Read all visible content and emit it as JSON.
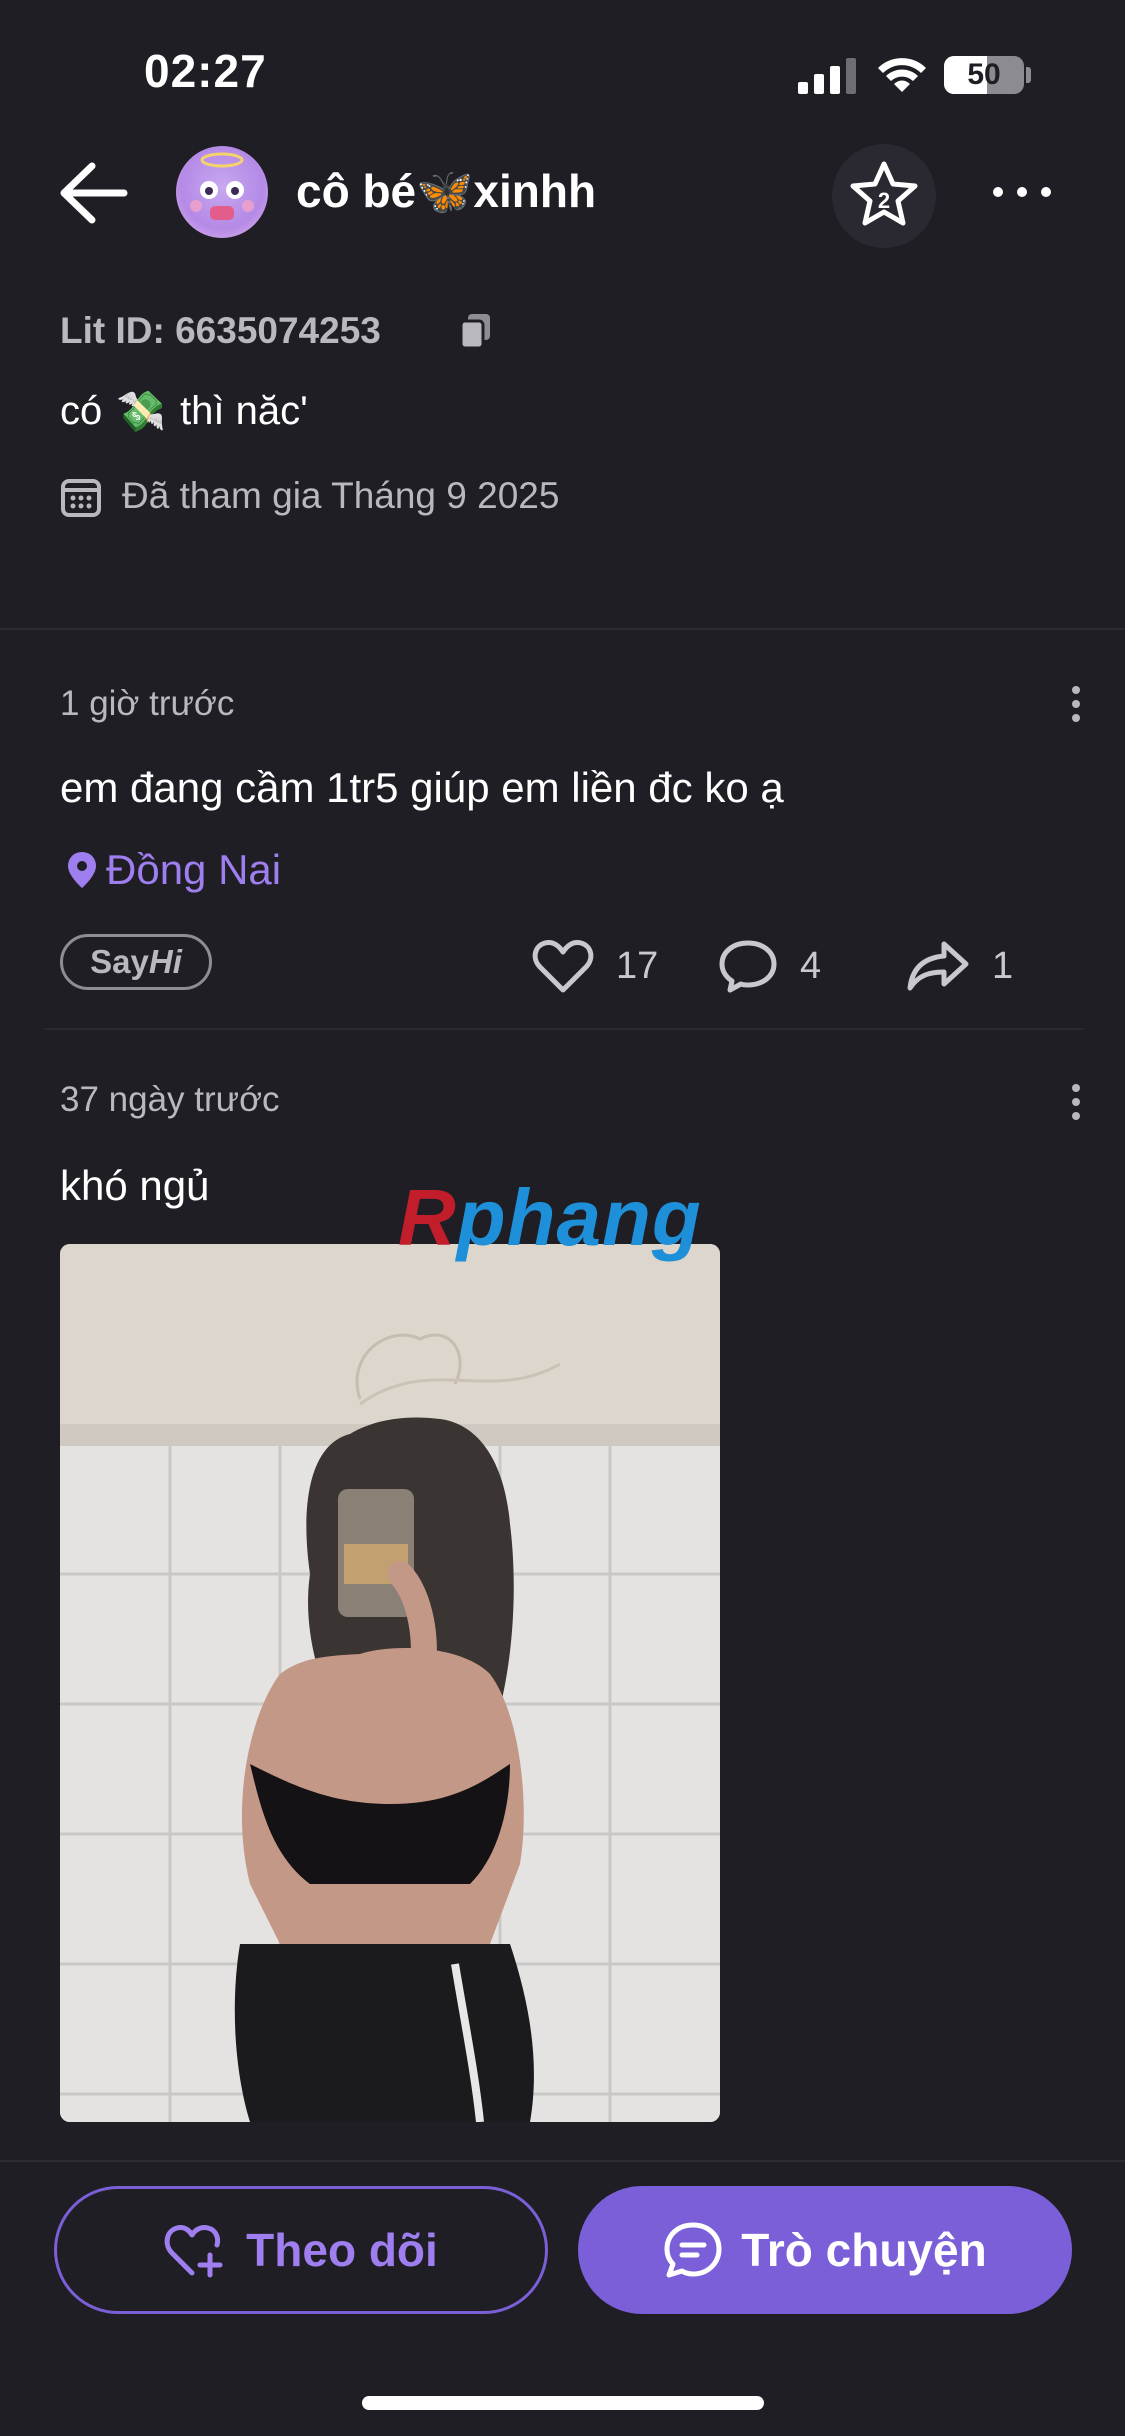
{
  "status_bar": {
    "time": "02:27",
    "battery": "50"
  },
  "header": {
    "profile_name": "cô bé🦋xinhh"
  },
  "profile": {
    "lit_id": "Lit ID: 6635074253",
    "bio_prefix": "có",
    "bio_emoji": "💸",
    "bio_suffix": "thì năc'",
    "joined": "Đã tham gia Tháng 9 2025"
  },
  "posts": [
    {
      "time": "1 giờ trước",
      "text": "em đang cầm 1tr5 giúp em liền đc ko ạ",
      "location": "Đồng Nai",
      "badge_say": "Say",
      "badge_hi": "Hi",
      "likes": "17",
      "comments": "4",
      "shares": "1"
    },
    {
      "time": "37 ngày trước",
      "text": "khó ngủ"
    }
  ],
  "watermark": {
    "first": "R",
    "rest": "phang"
  },
  "actions": {
    "follow_label": "Theo dõi",
    "chat_label": "Trò chuyện"
  },
  "colors": {
    "accent": "#7b5fd8",
    "accent_text": "#9f7ef0",
    "background": "#1f1e25"
  }
}
